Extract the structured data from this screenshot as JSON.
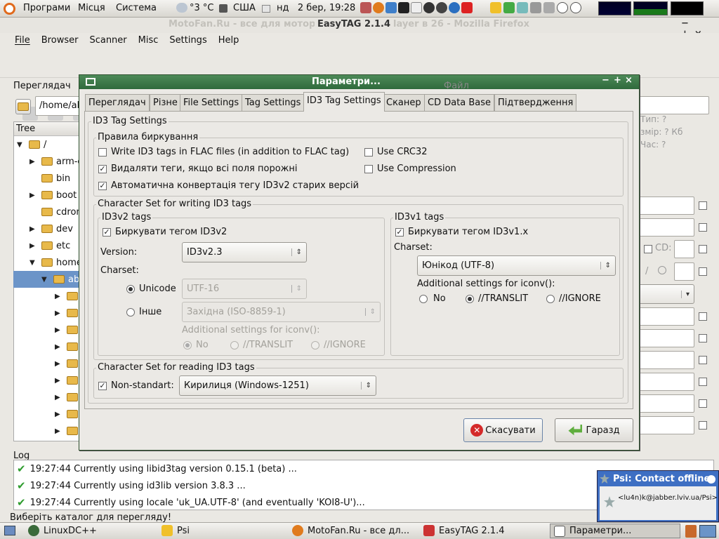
{
  "top_panel": {
    "applications": "Програми",
    "places": "Місця",
    "system": "Система",
    "weather": "°3 °C",
    "layout": "США",
    "clock": "нд   2 бер, 19:28"
  },
  "firefox_title": "MotoFan.Ru - все для мотор",
  "firefox_title_right": "layer в 26 - Mozilla Firefox",
  "easytag": {
    "title": "EasyTAG 2.1.4",
    "menu": [
      "File",
      "Browser",
      "Scanner",
      "Misc",
      "Settings",
      "Help"
    ],
    "browser_label": "Переглядач",
    "path": "/home/ab",
    "tree_header": "Tree",
    "tree": [
      {
        "name": "/",
        "indent": 0,
        "exp": "open"
      },
      {
        "name": "arm-e",
        "indent": 1,
        "exp": "closed"
      },
      {
        "name": "bin",
        "indent": 1,
        "exp": "none"
      },
      {
        "name": "boot",
        "indent": 1,
        "exp": "closed"
      },
      {
        "name": "cdron",
        "indent": 1,
        "exp": "none"
      },
      {
        "name": "dev",
        "indent": 1,
        "exp": "closed"
      },
      {
        "name": "etc",
        "indent": 1,
        "exp": "closed"
      },
      {
        "name": "home",
        "indent": 1,
        "exp": "open"
      },
      {
        "name": "ab",
        "indent": 2,
        "exp": "open",
        "selected": true
      },
      {
        "name": "",
        "indent": 3,
        "exp": "closed"
      },
      {
        "name": "",
        "indent": 3,
        "exp": "closed"
      },
      {
        "name": "",
        "indent": 3,
        "exp": "closed"
      },
      {
        "name": "",
        "indent": 3,
        "exp": "closed"
      },
      {
        "name": "",
        "indent": 3,
        "exp": "closed"
      },
      {
        "name": "",
        "indent": 3,
        "exp": "closed"
      },
      {
        "name": "",
        "indent": 3,
        "exp": "closed"
      },
      {
        "name": "",
        "indent": 3,
        "exp": "closed"
      },
      {
        "name": "",
        "indent": 3,
        "exp": "closed"
      }
    ],
    "file_label": "Файл",
    "info": {
      "type": "Тип: ?",
      "size": "змір: ? Кб",
      "time": "Час: ?"
    },
    "cd_label": "CD:",
    "log_label": "Log",
    "log": [
      "19:27:44  Currently using libid3tag version 0.15.1 (beta) ...",
      "19:27:44  Currently using id3lib version 3.8.3 ...",
      "19:27:44  Currently using locale 'uk_UA.UTF-8' (and eventually 'KOI8-U')..."
    ],
    "status": "Виберіть каталог для перегляду!"
  },
  "dialog": {
    "title": "Параметри...",
    "tabs": [
      "Переглядач",
      "Різне",
      "File Settings",
      "Tag Settings",
      "ID3 Tag Settings",
      "Сканер",
      "CD Data Base",
      "Підтвердження"
    ],
    "section_title": "ID3 Tag Settings",
    "rules": {
      "title": "Правила биркування",
      "write_flac": {
        "label": "Write ID3 tags in FLAC files (in addition to FLAC tag)",
        "checked": false
      },
      "use_crc": {
        "label": "Use CRC32",
        "checked": false
      },
      "remove_empty": {
        "label": "Видаляти теги, якщо всі поля порожні",
        "checked": true
      },
      "use_compression": {
        "label": "Use Compression",
        "checked": false
      },
      "auto_convert": {
        "label": "Автоматична конвертація тегу ID3v2 старих версій",
        "checked": true
      }
    },
    "write_charset": {
      "title": "Character Set for writing ID3 tags",
      "v2": {
        "title": "ID3v2 tags",
        "tag_label": "Биркувати тегом ID3v2",
        "tag_checked": true,
        "version_label": "Version:",
        "version_value": "ID3v2.3",
        "charset_label": "Charset:",
        "unicode_label": "Unicode",
        "unicode_value": "UTF-16",
        "other_label": "Інше",
        "other_value": "Західна (ISO-8859-1)",
        "iconv_label": "Additional settings for iconv():",
        "no": "No",
        "translit": "//TRANSLIT",
        "ignore": "//IGNORE"
      },
      "v1": {
        "title": "ID3v1 tags",
        "tag_label": "Биркувати тегом ID3v1.x",
        "tag_checked": true,
        "charset_label": "Charset:",
        "charset_value": "Юнікод (UTF-8)",
        "iconv_label": "Additional settings for iconv():",
        "no": "No",
        "translit": "//TRANSLIT",
        "ignore": "//IGNORE"
      }
    },
    "read_charset": {
      "title": "Character Set for reading ID3 tags",
      "nonstd_label": "Non-standart:",
      "nonstd_checked": true,
      "value": "Кирилиця (Windows-1251)"
    },
    "cancel": "Скасувати",
    "ok": "Гаразд"
  },
  "psi_popup": {
    "title": "Psi: Contact offline",
    "jid": "<lu4n)k@jabber.lviv.ua/Psi>"
  },
  "taskbar": [
    "LinuxDC++",
    "Psi",
    "MotoFan.Ru - все дл...",
    "EasyTAG 2.1.4",
    "Параметри..."
  ],
  "colors": {
    "accent": "#4a7ab5",
    "selection": "#6b94c8",
    "titlebar": "#3c7a4a"
  }
}
